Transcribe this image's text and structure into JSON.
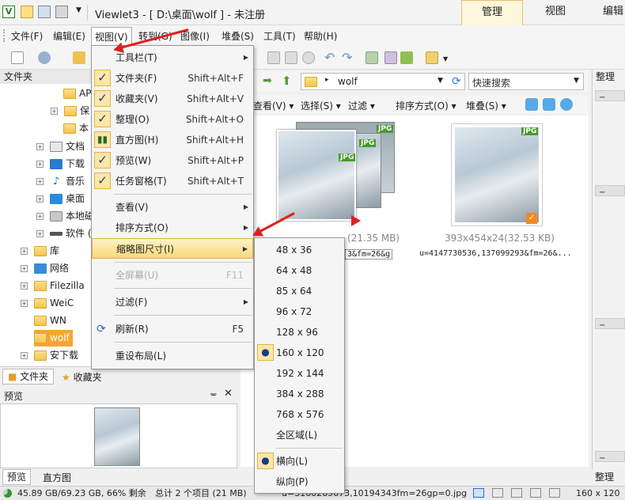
{
  "app": {
    "title": "Viewlet3 - [ D:\\桌面\\wolf ] - 未注册",
    "ribbon_tabs": [
      "管理",
      "视图",
      "编辑"
    ]
  },
  "menubar": [
    "文件(F)",
    "编辑(E)",
    "视图(V)",
    "转到(G)",
    "图像(I)",
    "堆叠(S)",
    "工具(T)",
    "帮助(H)"
  ],
  "folder_panel": {
    "title": "文件夹",
    "items": [
      {
        "label": "AP"
      },
      {
        "label": "保"
      },
      {
        "label": "本"
      },
      {
        "label": "文档"
      },
      {
        "label": "下载"
      },
      {
        "label": "音乐"
      },
      {
        "label": "桌面"
      },
      {
        "label": "本地磁"
      },
      {
        "label": "软件 ("
      },
      {
        "label": "库"
      },
      {
        "label": "网络"
      },
      {
        "label": "Filezilla"
      },
      {
        "label": "WeiC"
      },
      {
        "label": "WN"
      },
      {
        "label": "wolf"
      },
      {
        "label": "安下载"
      }
    ],
    "tabs": [
      "文件夹",
      "收藏夹"
    ]
  },
  "preview_panel": {
    "title": "预览",
    "tabs": [
      "预览",
      "直方图"
    ]
  },
  "address": {
    "path": "wolf",
    "search_placeholder": "快速搜索"
  },
  "viewbar": [
    "查看(V)",
    "选择(S)",
    "过滤",
    "排序方式(O)",
    "堆叠(S)"
  ],
  "right_panel": {
    "title": "整理",
    "bottom_tab": "整理"
  },
  "thumbnails": [
    {
      "badge": "JPG",
      "info": "(21.35 MB)",
      "filename": "3&fm=26&g"
    },
    {
      "badge": "JPG",
      "info": "393x454x24(32.53 KB)",
      "filename": "u=4147730536,137099293&fm=26&..."
    }
  ],
  "view_menu": {
    "items": [
      {
        "label": "工具栏(T)",
        "shortcut": "",
        "checked": false,
        "submenu": true
      },
      {
        "label": "文件夹(F)",
        "shortcut": "Shift+Alt+F",
        "checked": true
      },
      {
        "label": "收藏夹(V)",
        "shortcut": "Shift+Alt+V",
        "checked": true
      },
      {
        "label": "整理(O)",
        "shortcut": "Shift+Alt+O",
        "checked": true
      },
      {
        "label": "直方图(H)",
        "shortcut": "Shift+Alt+H",
        "checked": false
      },
      {
        "label": "预览(W)",
        "shortcut": "Shift+Alt+P",
        "checked": true
      },
      {
        "label": "任务窗格(T)",
        "shortcut": "Shift+Alt+T",
        "checked": true
      },
      {
        "label": "查看(V)",
        "shortcut": "",
        "submenu": true
      },
      {
        "label": "排序方式(O)",
        "shortcut": "",
        "submenu": true
      },
      {
        "label": "缩略图尺寸(I)",
        "shortcut": "",
        "submenu": true,
        "highlighted": true
      },
      {
        "label": "全屏幕(U)",
        "shortcut": "F11",
        "disabled": true
      },
      {
        "label": "过滤(F)",
        "shortcut": "",
        "submenu": true
      },
      {
        "label": "刷新(R)",
        "shortcut": "F5"
      },
      {
        "label": "重设布局(L)",
        "shortcut": ""
      }
    ]
  },
  "thumb_size_menu": {
    "items": [
      "48 x 36",
      "64 x 48",
      "85 x 64",
      "96 x 72",
      "128 x 96",
      "160 x 120",
      "192 x 144",
      "384 x 288",
      "768 x 576",
      "全区域(L)"
    ],
    "selected": "160 x 120",
    "orientation": [
      "横向(L)",
      "纵向(P)"
    ],
    "orientation_selected": "横向(L)"
  },
  "status": {
    "disk": "45.89 GB/69.23 GB, 66% 剩余",
    "count": "总计 2 个项目 (21 MB)",
    "file": "u=3160269673,10194343fm=26gp=0.jpg",
    "thumb_size": "160 x 120"
  },
  "colors": {
    "accent": "#f6a531",
    "arrow": "#e02020",
    "menu_highlight": "#f8d879"
  }
}
